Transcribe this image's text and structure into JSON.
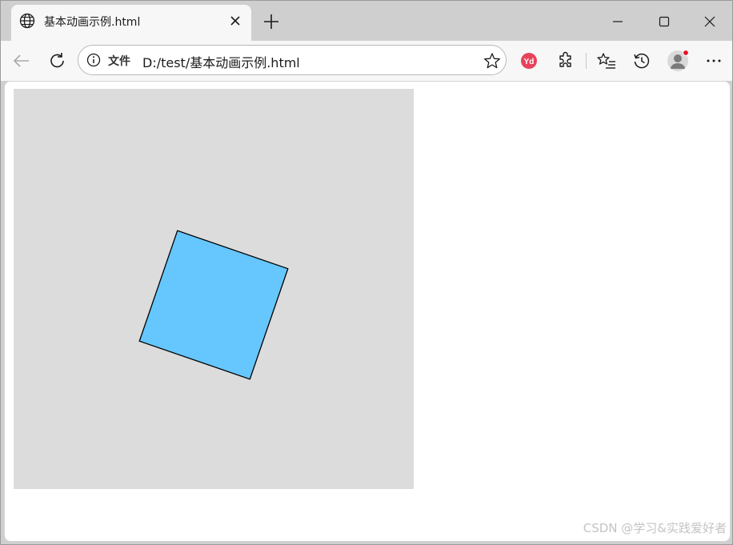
{
  "tab": {
    "title": "基本动画示例.html"
  },
  "address_bar": {
    "scheme_label": "文件",
    "url": "D:/test/基本动画示例.html"
  },
  "extension": {
    "badge_text": "Yd"
  },
  "icons": {
    "tab_favicon": "globe-icon",
    "tab_close": "close-icon",
    "new_tab": "plus-icon",
    "back": "arrow-left-icon",
    "refresh": "refresh-icon",
    "site_info": "info-icon",
    "favorite": "star-icon",
    "extensions": "puzzle-icon",
    "favorites": "favorites-list-icon",
    "history": "history-icon",
    "profile": "avatar",
    "menu": "more-horizontal-icon"
  },
  "canvas": {
    "background": "#dcdcdc",
    "square_fill": "#66c7ff",
    "square_stroke": "#000000",
    "rotation_deg": 19
  },
  "colors": {
    "tabstrip": "#cfcfcf",
    "toolbar": "#f7f7f7",
    "extension_badge": "#e8425c",
    "profile_dot": "#e81123"
  },
  "watermark": "CSDN @学习&实践爱好者"
}
